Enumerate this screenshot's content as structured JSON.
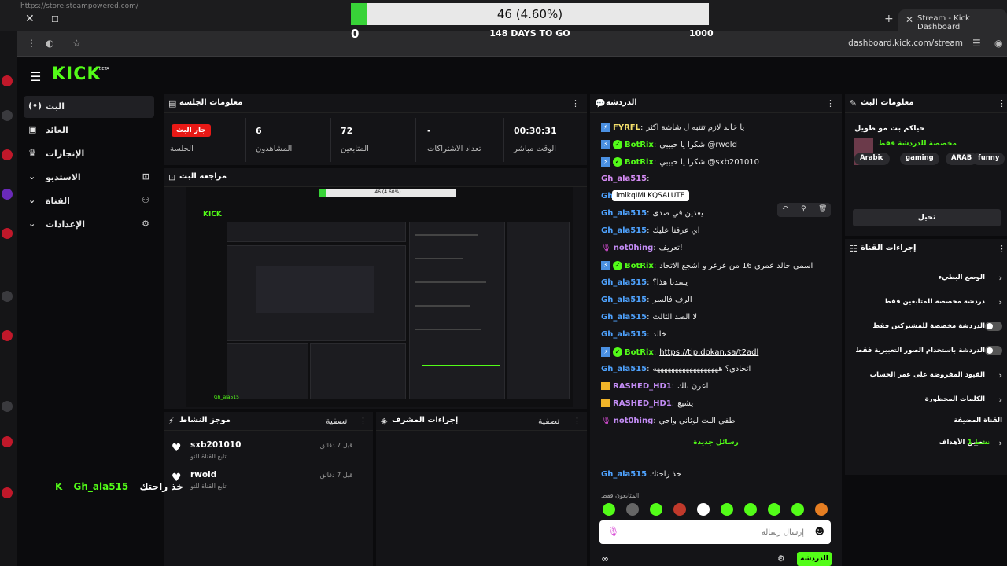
{
  "browser": {
    "status_url": "https://store.steampowered.com/",
    "tab_title": "Stream - Kick Dashboard",
    "address": "dashboard.kick.com/stream"
  },
  "goal": {
    "label": "46 (4.60%)",
    "min": "0",
    "max": "1000",
    "days_left": "148 DAYS TO GO",
    "progress_percent": 4.6
  },
  "colors": {
    "kick_green": "#53fc18",
    "live_red": "#e91916",
    "goal_green": "#38d338"
  },
  "app": {
    "logo": "KICK",
    "logo_sup": "BETA"
  },
  "sidebar": {
    "items": [
      {
        "label": "البث",
        "icon": "broadcast-icon"
      },
      {
        "label": "العائد",
        "icon": "revenue-icon"
      },
      {
        "label": "الإنجازات",
        "icon": "trophy-icon"
      },
      {
        "label": "الاستديو",
        "icon": "studio-icon"
      },
      {
        "label": "القناة",
        "icon": "channel-icon"
      },
      {
        "label": "الإعدادات",
        "icon": "gear-icon"
      }
    ]
  },
  "session": {
    "title": "معلومات الجلسة",
    "live_badge": "جار البث",
    "session_label": "الجلسة",
    "stats": [
      {
        "value": "6",
        "label": "المشاهدون"
      },
      {
        "value": "72",
        "label": "المتابعين"
      },
      {
        "value": "-",
        "label": "تعداد الاشتراكات"
      },
      {
        "value": "00:30:31",
        "label": "الوقت مباشر"
      }
    ]
  },
  "preview": {
    "title": "مراجعة البث",
    "inner_goal": "46 (4.60%)",
    "inner_kick": "KICK",
    "inner_user": "Gh_ala515"
  },
  "activity": {
    "title": "موجز النشاط",
    "filter": "تصفية",
    "items": [
      {
        "name": "sxb201010",
        "sub": "تابع القناة للتو",
        "time": "قبل 7 دقائق"
      },
      {
        "name": "rwold",
        "sub": "تابع القناة للتو",
        "time": "قبل 7 دقائق"
      }
    ]
  },
  "mod": {
    "title": "إجراءات المشرف",
    "filter": "تصفية"
  },
  "chat": {
    "title": "الدردشة",
    "tooltip": "imlkqIMLKQSALUTE",
    "new_messages": "رسائل جديدة",
    "followers_only": "المتابعون فقط",
    "input_placeholder": "إرسال رسالة",
    "send_label": "الدردشة",
    "messages": [
      {
        "user": "FYRFL",
        "type": "bolt",
        "color": "yellow",
        "text": "يا خالد لازم تنتبه ل شاشة اكثر"
      },
      {
        "user": "BotRix",
        "type": "bot",
        "color": "green",
        "text": "شكرا يا حبيبي @rwold"
      },
      {
        "user": "BotRix",
        "type": "bot",
        "color": "green",
        "text": "شكرا يا حبيبي @sxb201010"
      },
      {
        "user": "Gh_ala515",
        "type": "plain",
        "color": "pink",
        "text": ""
      },
      {
        "user": "Gh_ala515",
        "type": "plain",
        "color": "blue",
        "text": ""
      },
      {
        "user": "Gh_ala515",
        "type": "plain",
        "color": "blue",
        "text": "يعدين في صدى"
      },
      {
        "user": "Gh_ala515",
        "type": "plain",
        "color": "blue",
        "text": "اي عرفنا عليك"
      },
      {
        "user": "not0hing",
        "type": "mic",
        "color": "purple",
        "text": "تعريف!"
      },
      {
        "user": "BotRix",
        "type": "bot",
        "color": "green",
        "text": "اسمي خالد عمري 16 من عرعر و اشجع الاتحاد"
      },
      {
        "user": "Gh_ala515",
        "type": "plain",
        "color": "blue",
        "text": "يسدنا هذا؟"
      },
      {
        "user": "Gh_ala515",
        "type": "plain",
        "color": "blue",
        "text": "الرف فالسر"
      },
      {
        "user": "Gh_ala515",
        "type": "plain",
        "color": "blue",
        "text": "لا الصد الثالث"
      },
      {
        "user": "Gh_ala515",
        "type": "plain",
        "color": "blue",
        "text": "خالد"
      },
      {
        "user": "BotRix",
        "type": "bot",
        "color": "green",
        "text": "https://tip.dokan.sa/t2adl",
        "link": true
      },
      {
        "user": "Gh_ala515",
        "type": "plain",
        "color": "blue",
        "text": "اتحادي؟ ههههههههههههههههههه"
      },
      {
        "user": "RASHED_HD1",
        "type": "crown",
        "color": "purple",
        "text": "اعرن بلك"
      },
      {
        "user": "RASHED_HD1",
        "type": "crown",
        "color": "purple",
        "text": "يشيع"
      },
      {
        "user": "not0hing",
        "type": "mic",
        "color": "purple",
        "text": "طفي النت لوثاني واجي"
      }
    ],
    "after_new": {
      "user": "Gh_ala515",
      "text": "خذ راحتك"
    }
  },
  "stream_info": {
    "title": "معلومات البث",
    "stream_title": "حياكم بث مو طويل",
    "category": "مخصصة للدردشة فقط",
    "tags": [
      "funny",
      "ARAB",
      "gaming",
      "Arabic"
    ],
    "edit_label": "تحيل"
  },
  "channel_actions": {
    "title": "إجراءات القناة",
    "rows": [
      {
        "label": "الوضع البطيء",
        "control": "chevron"
      },
      {
        "label": "دردشة مخصصة للمتابعين فقط",
        "control": "chevron"
      },
      {
        "label": "الدردشة مخصصة للمشتركين فقط",
        "control": "toggle"
      },
      {
        "label": "الدردشة باستخدام الصور التعبيرية فقط",
        "control": "toggle"
      },
      {
        "label": "القيود المفروضة على عمر الحساب",
        "control": "chevron"
      },
      {
        "label": "الكلمات المحظورة",
        "control": "chevron"
      },
      {
        "label": "القناة المضيفة",
        "control": "none"
      },
      {
        "label": "تعيين الأهداف",
        "control": "count",
        "count": "1 نشط"
      }
    ]
  },
  "overlay_user": {
    "name": "Gh_ala515",
    "text": "خذ راحتك"
  }
}
